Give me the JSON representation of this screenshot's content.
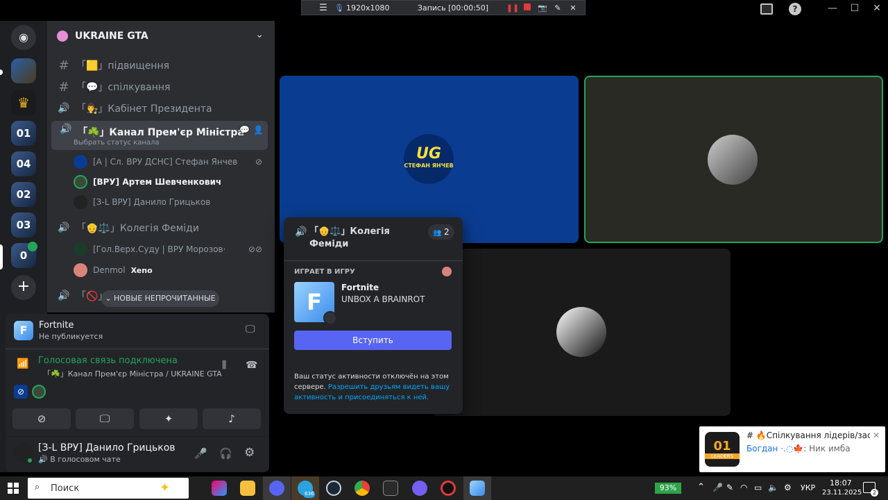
{
  "recbar": {
    "resolution": "1920x1080",
    "recording": "Запись [00:00:50]"
  },
  "server": {
    "name": "UKRAINE GTA"
  },
  "channels": [
    {
      "name": "「🟨」підвищення",
      "type": "text"
    },
    {
      "name": "「💬」спілкування",
      "type": "text"
    },
    {
      "name": "「👨‍⚖️」Кабінет Президента",
      "type": "voice"
    },
    {
      "name": "「☘️」Канал Прем'єр Міністра",
      "type": "voice",
      "status_hint": "Выбрать статус канала"
    },
    {
      "name": "「👴⚖️」Колегія Феміди",
      "type": "voice"
    },
    {
      "name": "「🚫」",
      "type": "voice"
    }
  ],
  "pm_members": [
    "[А | Сл. ВРУ ДСНС] Стефан Янчев",
    "[ВРУ] Артем Шевченкович",
    "[З-L ВРУ] Данило Грицьков"
  ],
  "femida_members": [
    {
      "name": "[Гол.Верх.Суду | ВРУ Морозов·",
      "tag": ""
    },
    {
      "name": "Denmol",
      "tag": "Xeno"
    }
  ],
  "unread_pill": "НОВЫЕ НЕПРОЧИТАННЫЕ",
  "activity": {
    "game": "Fortnite",
    "status": "Не публикуется"
  },
  "voice": {
    "connected": "Голосовая связь подключена",
    "channel": "「☘️」Канал Прем'єр Міністра / UKRAINE GTA"
  },
  "user": {
    "name": "[З-L ВРУ] Данило Грицьков",
    "status": "В голосовом чате"
  },
  "stage": {
    "tile1_label_top": "UG",
    "tile1_label_bottom": "СТЕФАН ЯНЧЕВ"
  },
  "popup": {
    "channel_name": "「👴⚖️」Колегія Феміди",
    "count": "2",
    "section": "ИГРАЕТ В ИГРУ",
    "game": "Fortnite",
    "game_detail": "UNBOX A BRAINROT",
    "join": "Вступить",
    "note_plain": "Ваш статус активности отключён на этом сервере.",
    "note_link": "Разрешить друзьям видеть вашу активность и присоединяться к ней."
  },
  "notif": {
    "title": "# 🔥Спілкування лідерів/засту...",
    "author": "Богдан ·.◌🍁",
    "message": ": Ник имба",
    "logo_top": "01",
    "logo_bottom": "LEADERS"
  },
  "taskbar": {
    "search": "Поиск",
    "battery": "93%",
    "lang": "УКР",
    "time": "18:07",
    "date": "23.11.2025",
    "telegram_badge": "636",
    "notif_count": "2"
  },
  "colors": {
    "accent": "#5865f2",
    "green": "#23a55a",
    "stage_blue": "#0a3d91"
  }
}
